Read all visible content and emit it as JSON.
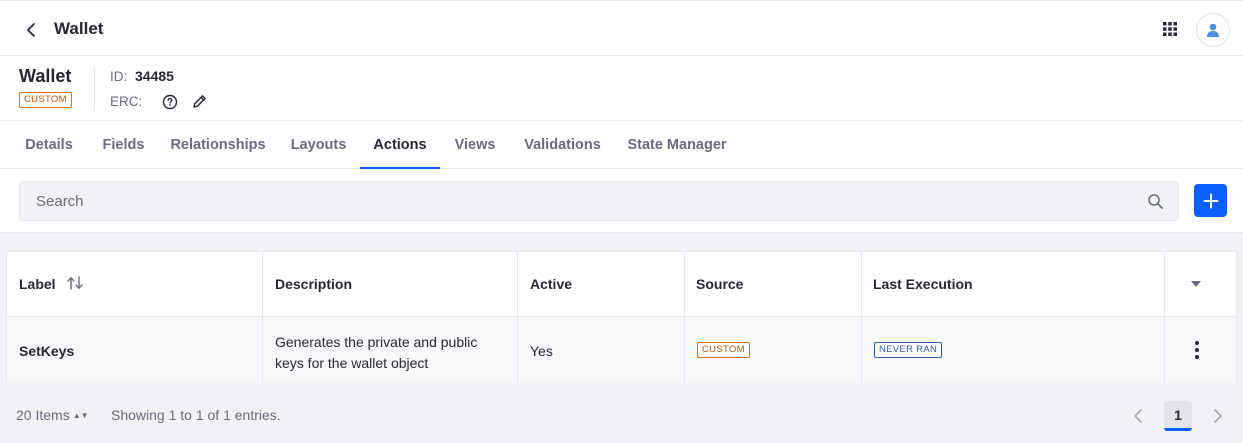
{
  "topbar": {
    "title": "Wallet",
    "back_icon": "chevron-left-icon",
    "apps_icon": "grid-icon",
    "user_icon": "user-icon"
  },
  "object": {
    "title": "Wallet",
    "badge": "CUSTOM",
    "id_label": "ID:",
    "id_value": "34485",
    "erc_label": "ERC:"
  },
  "tabs": [
    {
      "label": "Details",
      "active": false
    },
    {
      "label": "Fields",
      "active": false
    },
    {
      "label": "Relationships",
      "active": false
    },
    {
      "label": "Layouts",
      "active": false
    },
    {
      "label": "Actions",
      "active": true
    },
    {
      "label": "Views",
      "active": false
    },
    {
      "label": "Validations",
      "active": false
    },
    {
      "label": "State Manager",
      "active": false
    }
  ],
  "search": {
    "placeholder": "Search"
  },
  "table": {
    "columns": [
      "Label",
      "Description",
      "Active",
      "Source",
      "Last Execution"
    ],
    "rows": [
      {
        "label": "SetKeys",
        "description": "Generates the private and public keys for the wallet object",
        "active": "Yes",
        "source": "CUSTOM",
        "last_execution": "NEVER RAN"
      }
    ]
  },
  "footer": {
    "items_label": "20 Items",
    "showing": "Showing 1 to 1 of 1 entries.",
    "current_page": "1"
  },
  "colors": {
    "accent": "#0b5fff",
    "custom_badge": "#b95000",
    "never_ran_badge": "#2e5aac"
  }
}
